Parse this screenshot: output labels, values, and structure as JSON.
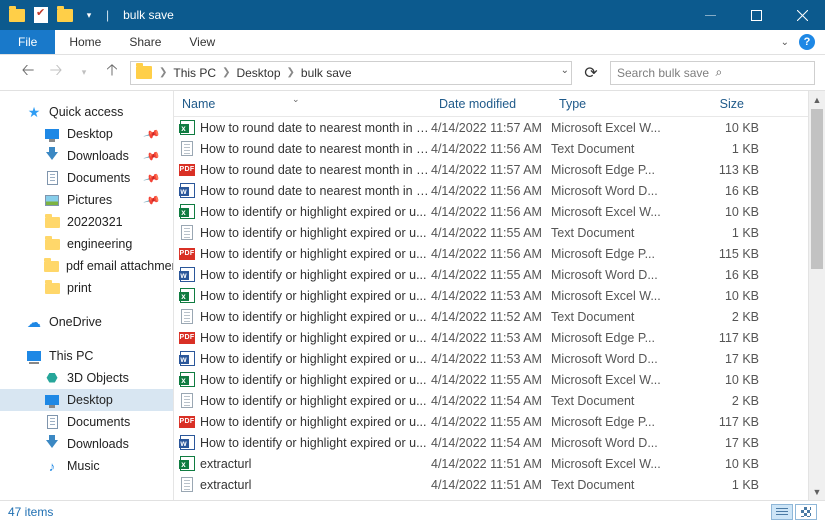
{
  "window": {
    "title": "bulk save"
  },
  "tabs": {
    "file": "File",
    "home": "Home",
    "share": "Share",
    "view": "View"
  },
  "breadcrumb": {
    "root": "This PC",
    "d1": "Desktop",
    "d2": "bulk save"
  },
  "search": {
    "placeholder": "Search bulk save"
  },
  "sidebar": {
    "quick": "Quick access",
    "desktop": "Desktop",
    "downloads": "Downloads",
    "documents": "Documents",
    "pictures": "Pictures",
    "f1": "20220321",
    "f2": "engineering",
    "f3": "pdf email attachments",
    "f4": "print",
    "onedrive": "OneDrive",
    "thispc": "This PC",
    "obj3d": "3D Objects",
    "desktop2": "Desktop",
    "documents2": "Documents",
    "downloads2": "Downloads",
    "music": "Music"
  },
  "columns": {
    "name": "Name",
    "date": "Date modified",
    "type": "Type",
    "size": "Size"
  },
  "files": [
    {
      "icon": "xlsx",
      "name": "How to round date to nearest month in E...",
      "date": "4/14/2022 11:57 AM",
      "type": "Microsoft Excel W...",
      "size": "10 KB"
    },
    {
      "icon": "txt",
      "name": "How to round date to nearest month in E...",
      "date": "4/14/2022 11:56 AM",
      "type": "Text Document",
      "size": "1 KB"
    },
    {
      "icon": "pdf",
      "name": "How to round date to nearest month in E...",
      "date": "4/14/2022 11:57 AM",
      "type": "Microsoft Edge P...",
      "size": "113 KB"
    },
    {
      "icon": "docx",
      "name": "How to round date to nearest month in E...",
      "date": "4/14/2022 11:56 AM",
      "type": "Microsoft Word D...",
      "size": "16 KB"
    },
    {
      "icon": "xlsx",
      "name": "How to identify or highlight expired or u...",
      "date": "4/14/2022 11:56 AM",
      "type": "Microsoft Excel W...",
      "size": "10 KB"
    },
    {
      "icon": "txt",
      "name": "How to identify or highlight expired or u...",
      "date": "4/14/2022 11:55 AM",
      "type": "Text Document",
      "size": "1 KB"
    },
    {
      "icon": "pdf",
      "name": "How to identify or highlight expired or u...",
      "date": "4/14/2022 11:56 AM",
      "type": "Microsoft Edge P...",
      "size": "115 KB"
    },
    {
      "icon": "docx",
      "name": "How to identify or highlight expired or u...",
      "date": "4/14/2022 11:55 AM",
      "type": "Microsoft Word D...",
      "size": "16 KB"
    },
    {
      "icon": "xlsx",
      "name": "How to identify or highlight expired or u...",
      "date": "4/14/2022 11:53 AM",
      "type": "Microsoft Excel W...",
      "size": "10 KB"
    },
    {
      "icon": "txt",
      "name": "How to identify or highlight expired or u...",
      "date": "4/14/2022 11:52 AM",
      "type": "Text Document",
      "size": "2 KB"
    },
    {
      "icon": "pdf",
      "name": "How to identify or highlight expired or u...",
      "date": "4/14/2022 11:53 AM",
      "type": "Microsoft Edge P...",
      "size": "117 KB"
    },
    {
      "icon": "docx",
      "name": "How to identify or highlight expired or u...",
      "date": "4/14/2022 11:53 AM",
      "type": "Microsoft Word D...",
      "size": "17 KB"
    },
    {
      "icon": "xlsx",
      "name": "How to identify or highlight expired or u...",
      "date": "4/14/2022 11:55 AM",
      "type": "Microsoft Excel W...",
      "size": "10 KB"
    },
    {
      "icon": "txt",
      "name": "How to identify or highlight expired or u...",
      "date": "4/14/2022 11:54 AM",
      "type": "Text Document",
      "size": "2 KB"
    },
    {
      "icon": "pdf",
      "name": "How to identify or highlight expired or u...",
      "date": "4/14/2022 11:55 AM",
      "type": "Microsoft Edge P...",
      "size": "117 KB"
    },
    {
      "icon": "docx",
      "name": "How to identify or highlight expired or u...",
      "date": "4/14/2022 11:54 AM",
      "type": "Microsoft Word D...",
      "size": "17 KB"
    },
    {
      "icon": "xlsx",
      "name": "extracturl",
      "date": "4/14/2022 11:51 AM",
      "type": "Microsoft Excel W...",
      "size": "10 KB"
    },
    {
      "icon": "txt",
      "name": "extracturl",
      "date": "4/14/2022 11:51 AM",
      "type": "Text Document",
      "size": "1 KB"
    }
  ],
  "status": {
    "count": "47 items"
  }
}
